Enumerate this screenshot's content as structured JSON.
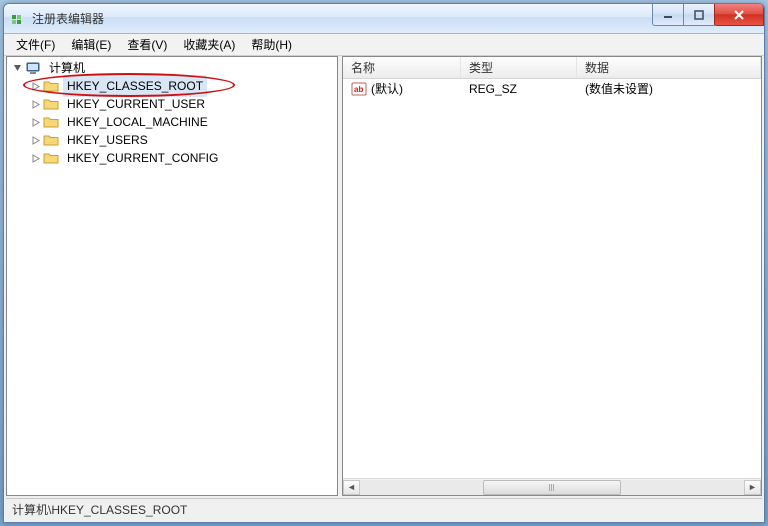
{
  "window": {
    "title": "注册表编辑器"
  },
  "menu": {
    "file": "文件(F)",
    "edit": "编辑(E)",
    "view": "查看(V)",
    "favorites": "收藏夹(A)",
    "help": "帮助(H)"
  },
  "tree": {
    "root": "计算机",
    "nodes": [
      "HKEY_CLASSES_ROOT",
      "HKEY_CURRENT_USER",
      "HKEY_LOCAL_MACHINE",
      "HKEY_USERS",
      "HKEY_CURRENT_CONFIG"
    ],
    "selected": "HKEY_CLASSES_ROOT"
  },
  "list": {
    "columns": {
      "name": "名称",
      "type": "类型",
      "data": "数据"
    },
    "rows": [
      {
        "name": "(默认)",
        "type": "REG_SZ",
        "data": "(数值未设置)"
      }
    ]
  },
  "status": "计算机\\HKEY_CLASSES_ROOT"
}
